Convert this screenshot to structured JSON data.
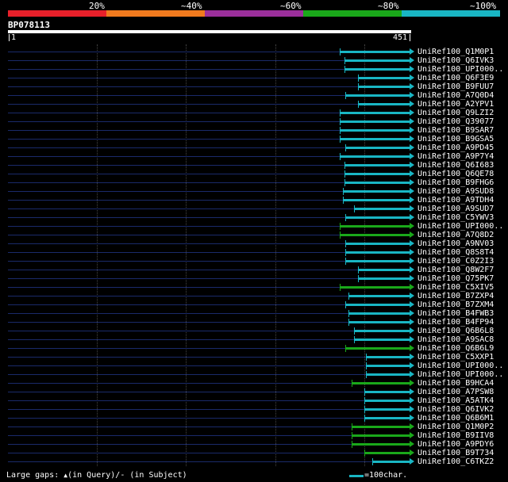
{
  "identity_legend": {
    "labels": [
      "20%",
      "~40%",
      "~60%",
      "~80%",
      "~100%"
    ],
    "colors": [
      "#e8202a",
      "#f07a1e",
      "#9b2f9b",
      "#1aa81a",
      "#19b6c4"
    ]
  },
  "query": {
    "id": "BP078113",
    "start": "1",
    "end": "451"
  },
  "hits": [
    {
      "label": "UniRef100_Q1M0P1",
      "start": 373,
      "color": "#19b6c4"
    },
    {
      "label": "UniRef100_Q6IVK3",
      "start": 378,
      "color": "#19b6c4"
    },
    {
      "label": "UniRef100_UPI000..",
      "start": 378,
      "color": "#19b6c4"
    },
    {
      "label": "UniRef100_Q6F3E9",
      "start": 393,
      "color": "#19b6c4"
    },
    {
      "label": "UniRef100_B9FUU7",
      "start": 393,
      "color": "#19b6c4"
    },
    {
      "label": "UniRef100_A7Q0D4",
      "start": 379,
      "color": "#19b6c4"
    },
    {
      "label": "UniRef100_A2YPV1",
      "start": 393,
      "color": "#19b6c4"
    },
    {
      "label": "UniRef100_Q9LZI2",
      "start": 373,
      "color": "#19b6c4"
    },
    {
      "label": "UniRef100_Q39077",
      "start": 373,
      "color": "#19b6c4"
    },
    {
      "label": "UniRef100_B9SAR7",
      "start": 373,
      "color": "#19b6c4"
    },
    {
      "label": "UniRef100_B9GSA5",
      "start": 373,
      "color": "#19b6c4"
    },
    {
      "label": "UniRef100_A9PD45",
      "start": 379,
      "color": "#19b6c4"
    },
    {
      "label": "UniRef100_A9P7Y4",
      "start": 373,
      "color": "#19b6c4"
    },
    {
      "label": "UniRef100_Q6I683",
      "start": 378,
      "color": "#19b6c4"
    },
    {
      "label": "UniRef100_Q6QE78",
      "start": 378,
      "color": "#19b6c4"
    },
    {
      "label": "UniRef100_B9FHG6",
      "start": 378,
      "color": "#19b6c4"
    },
    {
      "label": "UniRef100_A9SUD8",
      "start": 376,
      "color": "#19b6c4"
    },
    {
      "label": "UniRef100_A9TDH4",
      "start": 376,
      "color": "#19b6c4"
    },
    {
      "label": "UniRef100_A9SUD7",
      "start": 389,
      "color": "#19b6c4"
    },
    {
      "label": "UniRef100_C5YWV3",
      "start": 379,
      "color": "#19b6c4"
    },
    {
      "label": "UniRef100_UPI000..",
      "start": 373,
      "color": "#1aa81a"
    },
    {
      "label": "UniRef100_A7Q8D2",
      "start": 373,
      "color": "#1aa81a"
    },
    {
      "label": "UniRef100_A9NV03",
      "start": 379,
      "color": "#19b6c4"
    },
    {
      "label": "UniRef100_Q8S8T4",
      "start": 379,
      "color": "#19b6c4"
    },
    {
      "label": "UniRef100_C0Z2I3",
      "start": 379,
      "color": "#19b6c4"
    },
    {
      "label": "UniRef100_Q8W2F7",
      "start": 393,
      "color": "#19b6c4"
    },
    {
      "label": "UniRef100_Q75PK7",
      "start": 393,
      "color": "#19b6c4"
    },
    {
      "label": "UniRef100_C5XIV5",
      "start": 373,
      "color": "#1aa81a"
    },
    {
      "label": "UniRef100_B7ZXP4",
      "start": 382,
      "color": "#19b6c4"
    },
    {
      "label": "UniRef100_B7ZXM4",
      "start": 379,
      "color": "#19b6c4"
    },
    {
      "label": "UniRef100_B4FWB3",
      "start": 382,
      "color": "#19b6c4"
    },
    {
      "label": "UniRef100_B4FP94",
      "start": 382,
      "color": "#19b6c4"
    },
    {
      "label": "UniRef100_Q6B6L8",
      "start": 389,
      "color": "#19b6c4"
    },
    {
      "label": "UniRef100_A9SAC8",
      "start": 389,
      "color": "#19b6c4"
    },
    {
      "label": "UniRef100_Q6B6L9",
      "start": 379,
      "color": "#1aa81a"
    },
    {
      "label": "UniRef100_C5XXP1",
      "start": 402,
      "color": "#19b6c4"
    },
    {
      "label": "UniRef100_UPI000..",
      "start": 402,
      "color": "#19b6c4"
    },
    {
      "label": "UniRef100_UPI000..",
      "start": 402,
      "color": "#19b6c4"
    },
    {
      "label": "UniRef100_B9HCA4",
      "start": 386,
      "color": "#1aa81a"
    },
    {
      "label": "UniRef100_A7PSW8",
      "start": 400,
      "color": "#19b6c4"
    },
    {
      "label": "UniRef100_A5ATK4",
      "start": 400,
      "color": "#19b6c4"
    },
    {
      "label": "UniRef100_Q6IVK2",
      "start": 400,
      "color": "#19b6c4"
    },
    {
      "label": "UniRef100_Q6B6M1",
      "start": 400,
      "color": "#19b6c4"
    },
    {
      "label": "UniRef100_Q1M0P2",
      "start": 386,
      "color": "#1aa81a"
    },
    {
      "label": "UniRef100_B9IIV8",
      "start": 386,
      "color": "#1aa81a"
    },
    {
      "label": "UniRef100_A9PDY6",
      "start": 386,
      "color": "#1aa81a"
    },
    {
      "label": "UniRef100_B9T734",
      "start": 400,
      "color": "#1aa81a"
    },
    {
      "label": "UniRef100_C6TKZ2",
      "start": 409,
      "color": "#19b6c4"
    }
  ],
  "footer": {
    "gaps_label": "Large gaps:",
    "query_gap": "(in Query)/",
    "subject_gap": "(in Subject)",
    "scale_label": "=100char."
  }
}
